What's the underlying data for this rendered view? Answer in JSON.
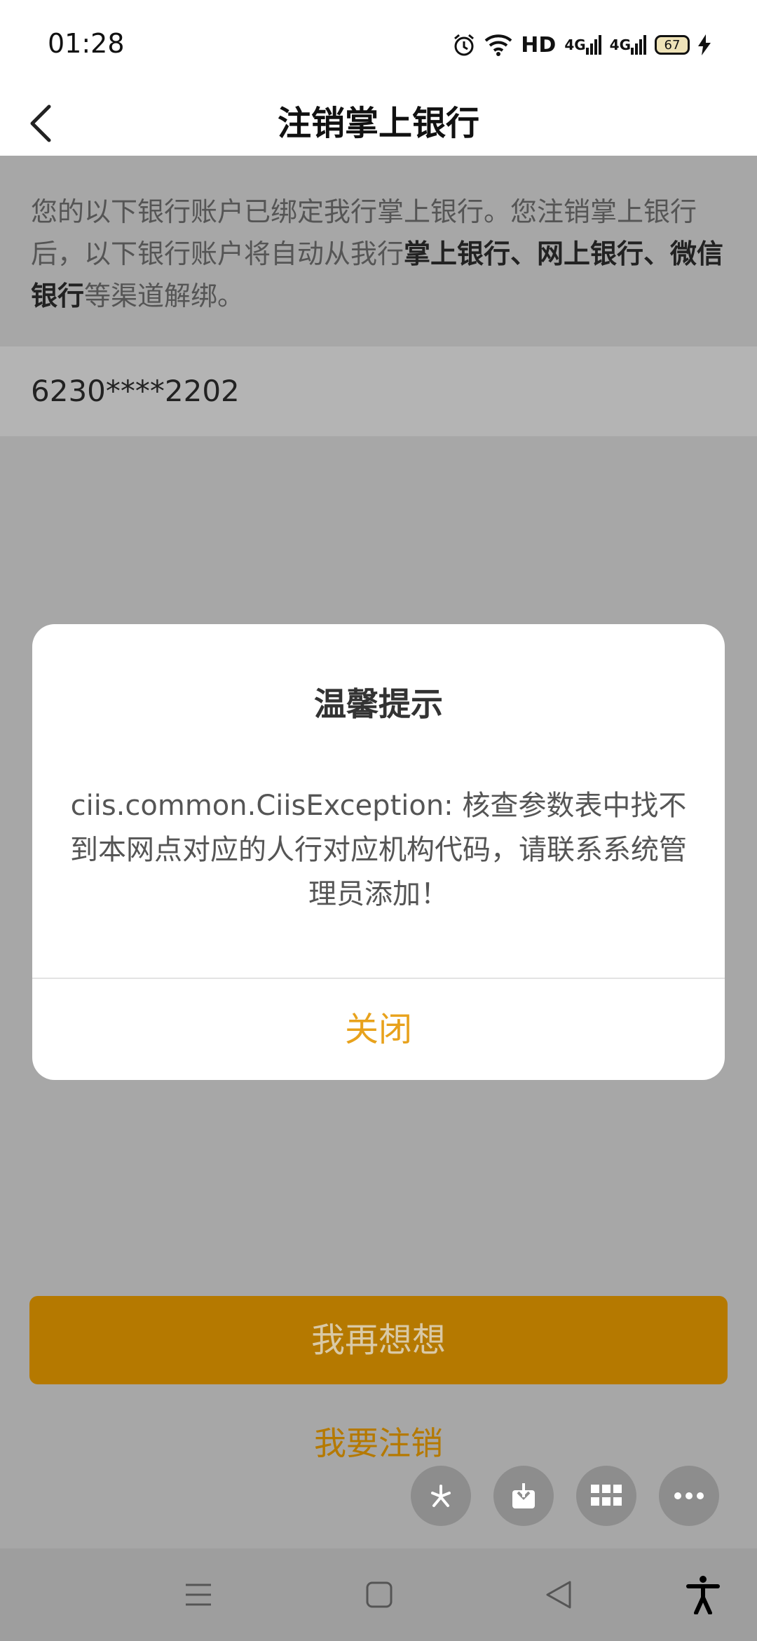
{
  "status_bar": {
    "time": "01:28",
    "hd_label": "HD",
    "signal_1": "4G",
    "signal_2": "4G",
    "battery": "67"
  },
  "header": {
    "title": "注销掌上银行"
  },
  "notice": {
    "part1": "您的以下银行账户已绑定我行掌上银行。您注销掌上银行后，以下银行账户将自动从我行",
    "bold": "掌上银行、网上银行、微信银行",
    "part2": "等渠道解绑。"
  },
  "account": {
    "number": "6230****2202"
  },
  "dialog": {
    "title": "温馨提示",
    "message": "ciis.common.CiisException: 核查参数表中找不到本网点对应的人行对应机构代码，请联系系统管理员添加！",
    "close_label": "关闭"
  },
  "actions": {
    "think_again": "我再想想",
    "confirm_cancel": "我要注销"
  },
  "colors": {
    "accent": "#b57900",
    "dialog_close": "#e8a21c",
    "overlay": "#a7a7a7"
  }
}
